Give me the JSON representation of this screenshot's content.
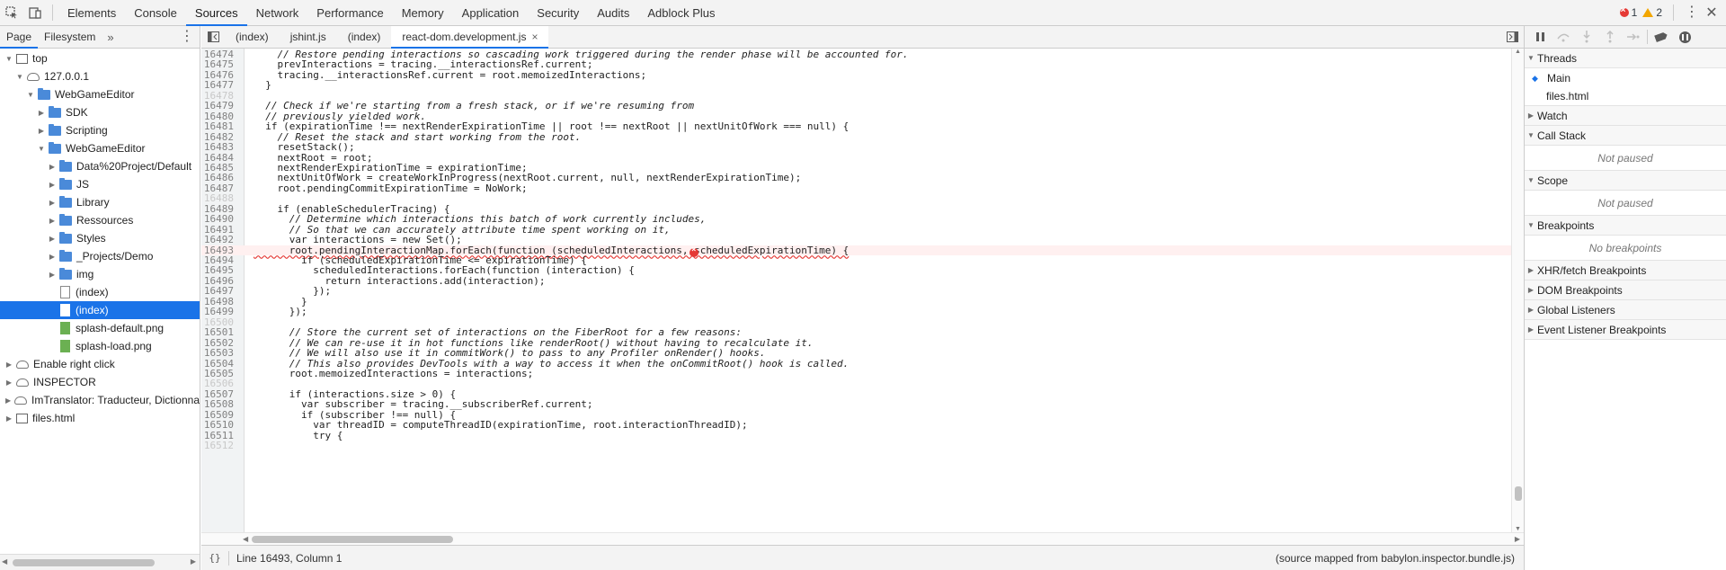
{
  "top_tabs": [
    "Elements",
    "Console",
    "Sources",
    "Network",
    "Performance",
    "Memory",
    "Application",
    "Security",
    "Audits",
    "Adblock Plus"
  ],
  "active_top_tab": "Sources",
  "error_count": "1",
  "warning_count": "2",
  "colors": {
    "accent": "#1a73e8",
    "error": "#e53935",
    "warning": "#f2a600",
    "folder": "#4a8ad9",
    "image_file": "#6bb052"
  },
  "navigator": {
    "tabs": [
      "Page",
      "Filesystem"
    ],
    "more": "»",
    "tree": [
      {
        "label": "top",
        "icon": "frame-icon",
        "arrow": "▼"
      },
      {
        "label": "127.0.0.1",
        "icon": "cloud-icon",
        "arrow": "▼"
      },
      {
        "label": "WebGameEditor",
        "icon": "folder-icon",
        "arrow": "▼"
      },
      {
        "label": "SDK",
        "icon": "folder-icon",
        "arrow": "▶"
      },
      {
        "label": "Scripting",
        "icon": "folder-icon",
        "arrow": "▶"
      },
      {
        "label": "WebGameEditor",
        "icon": "folder-icon",
        "arrow": "▼"
      },
      {
        "label": "Data%20Project/Default",
        "icon": "folder-icon",
        "arrow": "▶"
      },
      {
        "label": "JS",
        "icon": "folder-icon",
        "arrow": "▶"
      },
      {
        "label": "Library",
        "icon": "folder-icon",
        "arrow": "▶"
      },
      {
        "label": "Ressources",
        "icon": "folder-icon",
        "arrow": "▶"
      },
      {
        "label": "Styles",
        "icon": "folder-icon",
        "arrow": "▶"
      },
      {
        "label": "_Projects/Demo",
        "icon": "folder-icon",
        "arrow": "▶"
      },
      {
        "label": "img",
        "icon": "folder-icon",
        "arrow": "▶"
      },
      {
        "label": "(index)",
        "icon": "file-icon",
        "arrow": ""
      },
      {
        "label": "(index)",
        "icon": "file-icon",
        "arrow": ""
      },
      {
        "label": "splash-default.png",
        "icon": "image-file-icon",
        "arrow": ""
      },
      {
        "label": "splash-load.png",
        "icon": "image-file-icon",
        "arrow": ""
      },
      {
        "label": "Enable right click",
        "icon": "cloud-icon",
        "arrow": "▶"
      },
      {
        "label": "INSPECTOR",
        "icon": "cloud-icon",
        "arrow": "▶"
      },
      {
        "label": "ImTranslator: Traducteur, Dictionna",
        "icon": "cloud-icon",
        "arrow": "▶"
      },
      {
        "label": "files.html",
        "icon": "frame-icon",
        "arrow": "▶"
      }
    ]
  },
  "file_tabs": [
    {
      "label": "(index)",
      "close": ""
    },
    {
      "label": "jshint.js",
      "close": ""
    },
    {
      "label": "(index)",
      "close": ""
    },
    {
      "label": "react-dom.development.js",
      "close": "×"
    }
  ],
  "code": {
    "lines": [
      {
        "n": "16474",
        "t": "    // Restore pending interactions so cascading work triggered during the render phase will be accounted for."
      },
      {
        "n": "16475",
        "t": "    prevInteractions = tracing.__interactionsRef.current;"
      },
      {
        "n": "16476",
        "t": "    tracing.__interactionsRef.current = root.memoizedInteractions;"
      },
      {
        "n": "16477",
        "t": "  }"
      },
      {
        "n": "16478",
        "t": ""
      },
      {
        "n": "16479",
        "t": "  // Check if we're starting from a fresh stack, or if we're resuming from"
      },
      {
        "n": "16480",
        "t": "  // previously yielded work."
      },
      {
        "n": "16481",
        "t": "  if (expirationTime !== nextRenderExpirationTime || root !== nextRoot || nextUnitOfWork === null) {"
      },
      {
        "n": "16482",
        "t": "    // Reset the stack and start working from the root."
      },
      {
        "n": "16483",
        "t": "    resetStack();"
      },
      {
        "n": "16484",
        "t": "    nextRoot = root;"
      },
      {
        "n": "16485",
        "t": "    nextRenderExpirationTime = expirationTime;"
      },
      {
        "n": "16486",
        "t": "    nextUnitOfWork = createWorkInProgress(nextRoot.current, null, nextRenderExpirationTime);"
      },
      {
        "n": "16487",
        "t": "    root.pendingCommitExpirationTime = NoWork;"
      },
      {
        "n": "16488",
        "t": ""
      },
      {
        "n": "16489",
        "t": "    if (enableSchedulerTracing) {"
      },
      {
        "n": "16490",
        "t": "      // Determine which interactions this batch of work currently includes,"
      },
      {
        "n": "16491",
        "t": "      // So that we can accurately attribute time spent working on it,"
      },
      {
        "n": "16492",
        "t": "      var interactions = new Set();"
      },
      {
        "n": "16493",
        "t": "      root.pendingInteractionMap.forEach(function (scheduledInteractions, scheduledExpirationTime) {"
      },
      {
        "n": "16494",
        "t": "        if (scheduledExpirationTime <= expirationTime) {"
      },
      {
        "n": "16495",
        "t": "          scheduledInteractions.forEach(function (interaction) {"
      },
      {
        "n": "16496",
        "t": "            return interactions.add(interaction);"
      },
      {
        "n": "16497",
        "t": "          });"
      },
      {
        "n": "16498",
        "t": "        }"
      },
      {
        "n": "16499",
        "t": "      });"
      },
      {
        "n": "16500",
        "t": ""
      },
      {
        "n": "16501",
        "t": "      // Store the current set of interactions on the FiberRoot for a few reasons:"
      },
      {
        "n": "16502",
        "t": "      // We can re-use it in hot functions like renderRoot() without having to recalculate it."
      },
      {
        "n": "16503",
        "t": "      // We will also use it in commitWork() to pass to any Profiler onRender() hooks."
      },
      {
        "n": "16504",
        "t": "      // This also provides DevTools with a way to access it when the onCommitRoot() hook is called."
      },
      {
        "n": "16505",
        "t": "      root.memoizedInteractions = interactions;"
      },
      {
        "n": "16506",
        "t": ""
      },
      {
        "n": "16507",
        "t": "      if (interactions.size > 0) {"
      },
      {
        "n": "16508",
        "t": "        var subscriber = tracing.__subscriberRef.current;"
      },
      {
        "n": "16509",
        "t": "        if (subscriber !== null) {"
      },
      {
        "n": "16510",
        "t": "          var threadID = computeThreadID(expirationTime, root.interactionThreadID);"
      },
      {
        "n": "16511",
        "t": "          try {"
      },
      {
        "n": "16512",
        "t": ""
      }
    ],
    "error_line": "16493"
  },
  "status": {
    "pretty_print": "{}",
    "cursor": "Line 16493, Column 1",
    "source_mapped": "(source mapped from babylon.inspector.bundle.js)"
  },
  "debugger": {
    "sections": {
      "threads": "Threads",
      "watch": "Watch",
      "call_stack": "Call Stack",
      "scope": "Scope",
      "breakpoints": "Breakpoints",
      "xhr": "XHR/fetch Breakpoints",
      "dom": "DOM Breakpoints",
      "global": "Global Listeners",
      "event": "Event Listener Breakpoints"
    },
    "threads": [
      "Main",
      "files.html"
    ],
    "call_stack_status": "Not paused",
    "scope_status": "Not paused",
    "breakpoints_status": "No breakpoints"
  }
}
